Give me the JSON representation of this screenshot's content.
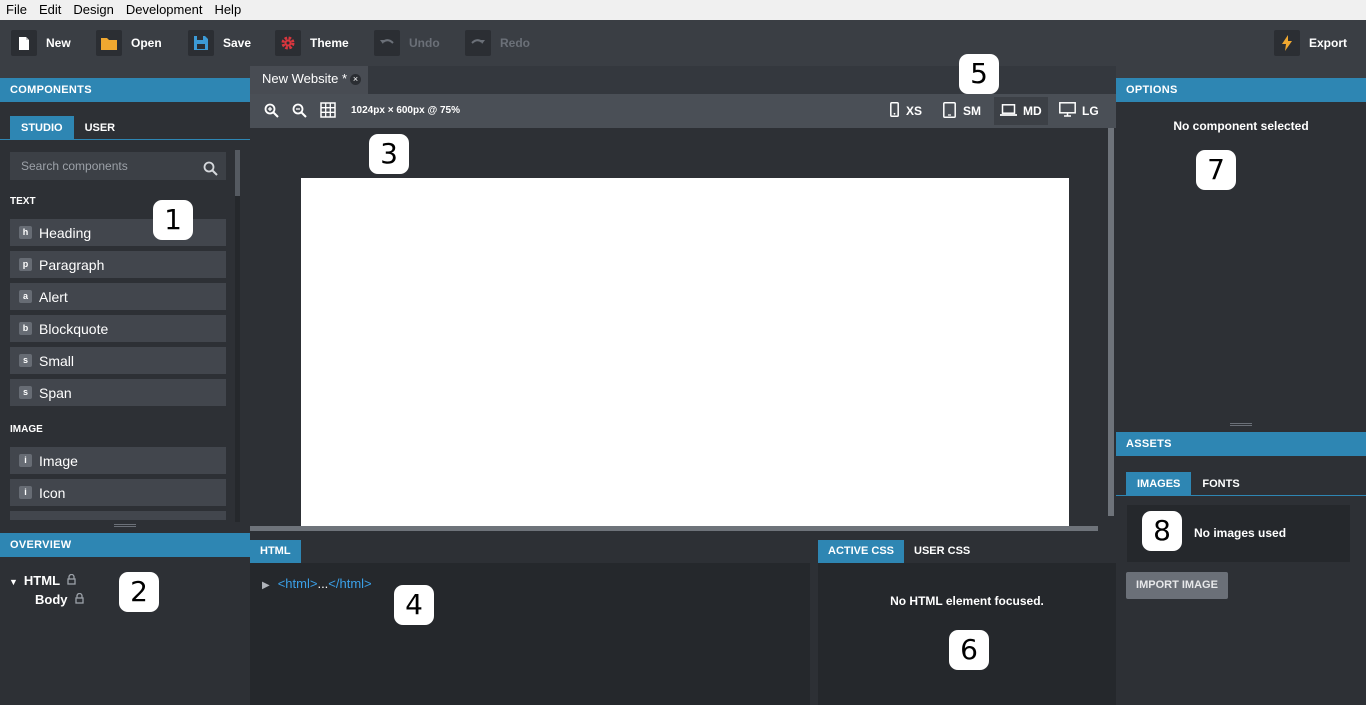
{
  "menu": [
    "File",
    "Edit",
    "Design",
    "Development",
    "Help"
  ],
  "toolbar": {
    "new_label": "New",
    "open_label": "Open",
    "save_label": "Save",
    "theme_label": "Theme",
    "undo_label": "Undo",
    "redo_label": "Redo",
    "export_label": "Export"
  },
  "components": {
    "title": "COMPONENTS",
    "tabs": [
      "STUDIO",
      "USER"
    ],
    "search_placeholder": "Search components",
    "sections": [
      {
        "name": "TEXT",
        "items": [
          {
            "badge": "h",
            "label": "Heading"
          },
          {
            "badge": "p",
            "label": "Paragraph"
          },
          {
            "badge": "a",
            "label": "Alert"
          },
          {
            "badge": "b",
            "label": "Blockquote"
          },
          {
            "badge": "s",
            "label": "Small"
          },
          {
            "badge": "s",
            "label": "Span"
          }
        ]
      },
      {
        "name": "IMAGE",
        "items": [
          {
            "badge": "i",
            "label": "Image"
          },
          {
            "badge": "i",
            "label": "Icon"
          }
        ]
      }
    ]
  },
  "overview": {
    "title": "OVERVIEW",
    "tree": [
      {
        "label": "HTML"
      },
      {
        "label": "Body"
      }
    ]
  },
  "document": {
    "tab_title": "New Website *",
    "view_info": "1024px × 600px @ 75%",
    "breakpoints": [
      "XS",
      "SM",
      "MD",
      "LG"
    ],
    "active_breakpoint": "MD"
  },
  "html_panel": {
    "title": "HTML",
    "root_node": "<html>",
    "ellipsis": "...",
    "closing_node": "</html>"
  },
  "css_panel": {
    "tabs": [
      "ACTIVE CSS",
      "USER CSS"
    ],
    "message": "No HTML element focused."
  },
  "options": {
    "title": "OPTIONS",
    "message": "No component selected"
  },
  "assets": {
    "title": "ASSETS",
    "tabs": [
      "IMAGES",
      "FONTS"
    ],
    "message": "No images used",
    "import_label": "IMPORT IMAGE"
  },
  "callouts": [
    "1",
    "2",
    "3",
    "4",
    "5",
    "6",
    "7",
    "8"
  ],
  "colors": {
    "accent": "#2e86b3",
    "panel_bg": "#2d3035",
    "toolbar_bg": "#3a3e44",
    "theme_icon": "#d9363e",
    "open_icon": "#f0a830",
    "save_icon": "#3c9ad6",
    "export_icon": "#f0a830",
    "link_blue": "#3aa0e8"
  }
}
